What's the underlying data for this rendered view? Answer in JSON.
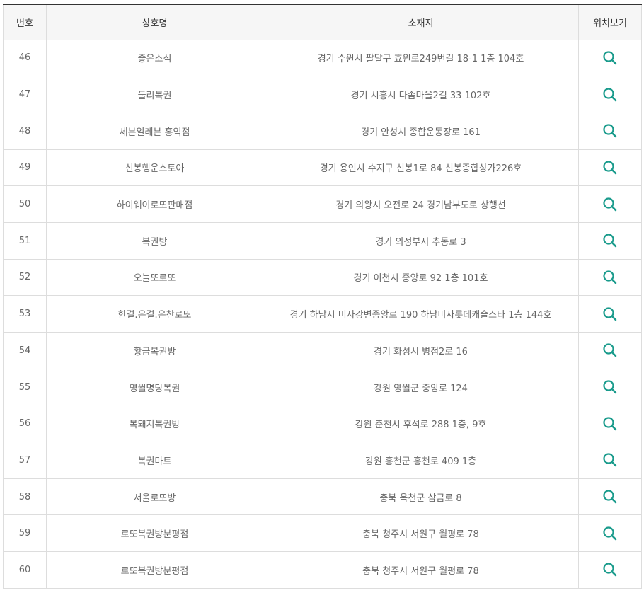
{
  "colors": {
    "header_border": "#333333",
    "icon": "#1a9b8c"
  },
  "table": {
    "headers": {
      "no": "번호",
      "name": "상호명",
      "address": "소재지",
      "map": "위치보기"
    },
    "rows": [
      {
        "no": "46",
        "name": "좋은소식",
        "address": "경기 수원시 팔달구 효원로249번길 18-1 1층 104호"
      },
      {
        "no": "47",
        "name": "둘리복권",
        "address": "경기 시흥시 다솜마을2길 33 102호"
      },
      {
        "no": "48",
        "name": "세븐일레븐 홍익점",
        "address": "경기 안성시 종합운동장로 161"
      },
      {
        "no": "49",
        "name": "신봉행운스토아",
        "address": "경기 용인시 수지구 신봉1로 84 신봉종합상가226호"
      },
      {
        "no": "50",
        "name": "하이웨이로또판매점",
        "address": "경기 의왕시 오전로 24 경기남부도로 상행선"
      },
      {
        "no": "51",
        "name": "복권방",
        "address": "경기 의정부시 추동로 3"
      },
      {
        "no": "52",
        "name": "오늘또로또",
        "address": "경기 이천시 중앙로 92 1층 101호"
      },
      {
        "no": "53",
        "name": "한결.은결.은찬로또",
        "address": "경기 하남시 미사강변중앙로 190 하남미사롯데캐슬스타 1층 144호"
      },
      {
        "no": "54",
        "name": "황금복권방",
        "address": "경기 화성시 병점2로 16"
      },
      {
        "no": "55",
        "name": "영월명당복권",
        "address": "강원 영월군 중앙로 124"
      },
      {
        "no": "56",
        "name": "복돼지복권방",
        "address": "강원 춘천시 후석로 288 1층, 9호"
      },
      {
        "no": "57",
        "name": "복권마트",
        "address": "강원 홍천군 홍천로 409 1층"
      },
      {
        "no": "58",
        "name": "서울로또방",
        "address": "충북 옥천군 삼금로 8"
      },
      {
        "no": "59",
        "name": "로또복권방분평점",
        "address": "충북 청주시 서원구 월평로 78"
      },
      {
        "no": "60",
        "name": "로또복권방분평점",
        "address": "충북 청주시 서원구 월평로 78"
      }
    ],
    "map_icon": "search-icon"
  }
}
